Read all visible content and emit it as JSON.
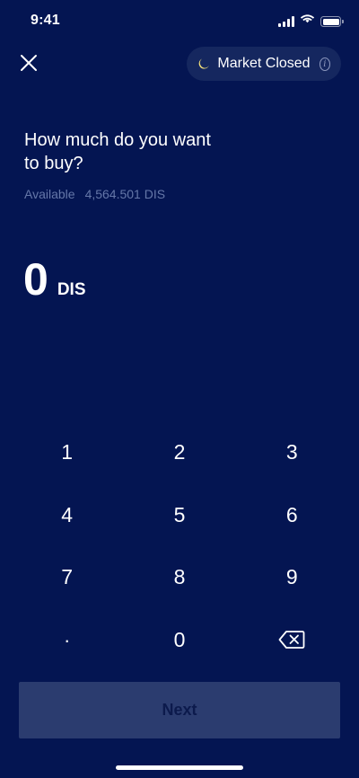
{
  "status_bar": {
    "time": "9:41",
    "icons": [
      "signal-icon",
      "wifi-icon",
      "battery-icon"
    ]
  },
  "header": {
    "close_icon": "close-icon",
    "market_status": {
      "icon": "moon-icon",
      "label": "Market Closed",
      "info_icon": "info-icon",
      "info_glyph": "i"
    }
  },
  "main": {
    "question": "How much do you want to buy?",
    "available_label": "Available",
    "available_value": "4,564.501 DIS",
    "amount_value": "0",
    "amount_unit": "DIS"
  },
  "keypad": {
    "keys": [
      "1",
      "2",
      "3",
      "4",
      "5",
      "6",
      "7",
      "8",
      "9",
      ".",
      "0"
    ],
    "backspace_icon": "backspace-icon"
  },
  "footer": {
    "next_label": "Next"
  },
  "colors": {
    "background": "#041552",
    "pill_background": "#15275f",
    "muted_text": "#6577a8",
    "button_disabled_bg": "#2b3c6f",
    "button_disabled_text": "#0c1a4c",
    "moon": "#f6e27a"
  }
}
